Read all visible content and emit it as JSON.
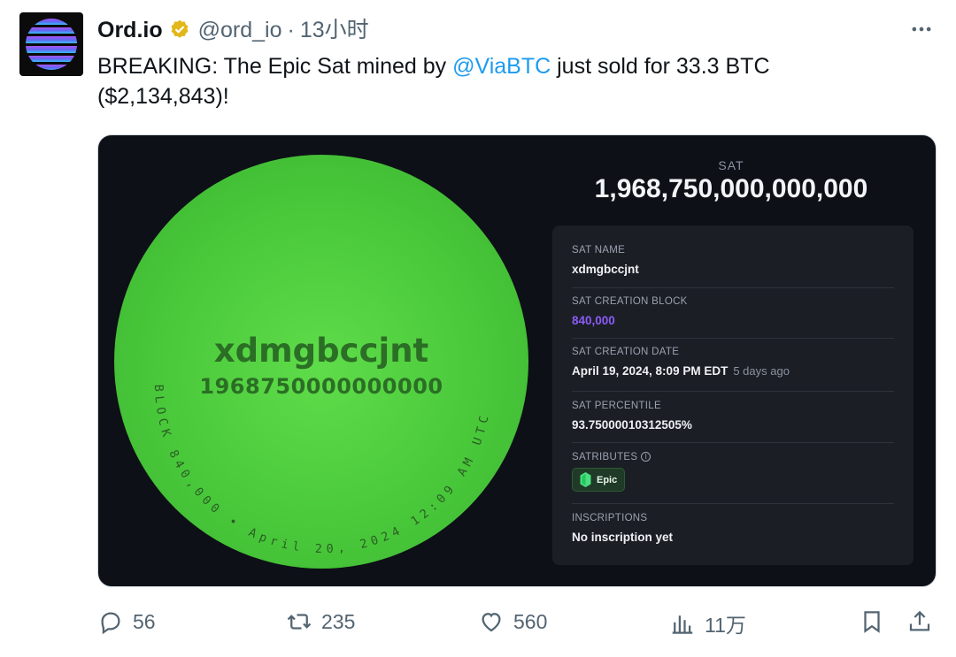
{
  "author": {
    "name": "Ord.io",
    "handle": "@ord_io",
    "separator": "·",
    "time": "13小时"
  },
  "tweet": {
    "text_before": "BREAKING: The Epic Sat mined by ",
    "mention": "@ViaBTC",
    "text_after": " just sold for 33.3 BTC ($2,134,843)!"
  },
  "card": {
    "sat_name_display": "xdmgbccjnt",
    "sat_number_display": "1968750000000000",
    "arc_text": "BLOCK 840,000 • April 20, 2024 12:09 AM UTC",
    "sat_label": "SAT",
    "sat_value": "1,968,750,000,000,000",
    "details": {
      "sat_name_label": "SAT NAME",
      "sat_name_value": "xdmgbccjnt",
      "creation_block_label": "SAT CREATION BLOCK",
      "creation_block_value": "840,000",
      "creation_date_label": "SAT CREATION DATE",
      "creation_date_value": "April 19, 2024, 8:09 PM EDT",
      "creation_date_ago": "5 days ago",
      "percentile_label": "SAT PERCENTILE",
      "percentile_value": "93.75000010312505%",
      "satributes_label": "SATRIBUTES",
      "satributes_info": "i",
      "satribute_badge": "Epic",
      "inscriptions_label": "INSCRIPTIONS",
      "inscriptions_value": "No inscription yet"
    },
    "colors": {
      "card_bg": "#0d1017",
      "panel_bg": "#1b1e25",
      "sat_green": "#49c83a",
      "block_link": "#8b5cf6"
    }
  },
  "actions": {
    "replies": "56",
    "retweets": "235",
    "likes": "560",
    "views": "11万"
  }
}
